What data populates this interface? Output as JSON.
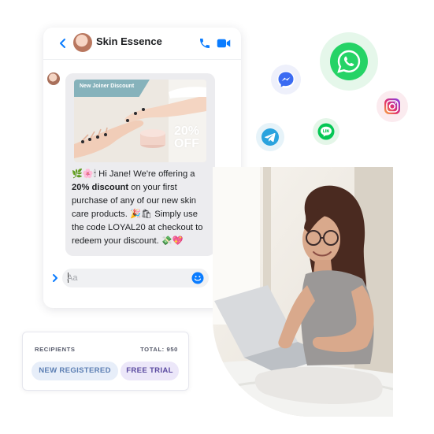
{
  "chat": {
    "contact_name": "Skin Essence",
    "promo": {
      "tag": "New Joiner Discount",
      "percent": "20%",
      "off": "OFF"
    },
    "message": {
      "emojis_start": "🌿🌸🕯",
      "part1": " Hi Jane! We're offering a ",
      "bold": "20% discount",
      "part2": " on your first purchase of any of our new skin care products. ",
      "emojis_mid": "🎉🛍",
      "part3": " Simply use the code LOYAL20 at checkout to redeem your discount. ",
      "emojis_end": "💸💖"
    },
    "composer": {
      "placeholder": "Aa"
    }
  },
  "recipients": {
    "label": "RECIPIENTS",
    "total": "TOTAL: 950",
    "chips": [
      "NEW REGISTERED",
      "FREE TRIAL"
    ]
  },
  "colors": {
    "messenger_blue": "#0a7cff",
    "whatsapp_green": "#25d366",
    "line_green": "#06c755",
    "telegram_blue": "#2aa3de",
    "chip_new_bg": "#e7eef9",
    "chip_trial_bg": "#ece7f9"
  },
  "icons": [
    "back-arrow-icon",
    "phone-icon",
    "video-icon",
    "send-arrow-icon",
    "emoji-icon",
    "thumbs-up-icon",
    "messenger-icon",
    "whatsapp-icon",
    "instagram-icon",
    "telegram-icon",
    "line-icon"
  ]
}
